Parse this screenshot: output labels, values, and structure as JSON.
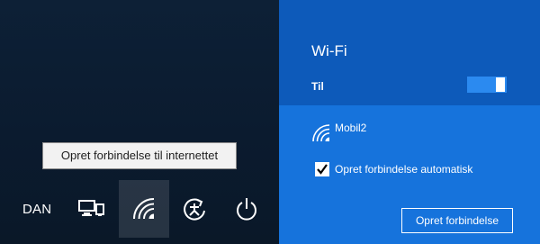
{
  "lock_screen": {
    "tooltip": "Opret forbindelse til internettet",
    "language": "DAN",
    "tray_icons": [
      {
        "icon": "network-computers-icon"
      },
      {
        "icon": "wifi-icon",
        "selected": true
      },
      {
        "icon": "ease-of-access-icon"
      },
      {
        "icon": "power-icon"
      }
    ]
  },
  "wifi_flyout": {
    "title": "Wi-Fi",
    "toggle_label": "Til",
    "toggle_on": true,
    "network": {
      "icon": "wifi-secured-icon",
      "name": "Mobil2"
    },
    "auto_connect": {
      "label": "Opret forbindelse automatisk",
      "checked": true
    },
    "connect_button": "Opret forbindelse"
  },
  "colors": {
    "lock_bg": "#0b1b2f",
    "flyout_header": "#0d5aba",
    "flyout_list": "#1673dc",
    "toggle_on": "#2b8af0"
  }
}
